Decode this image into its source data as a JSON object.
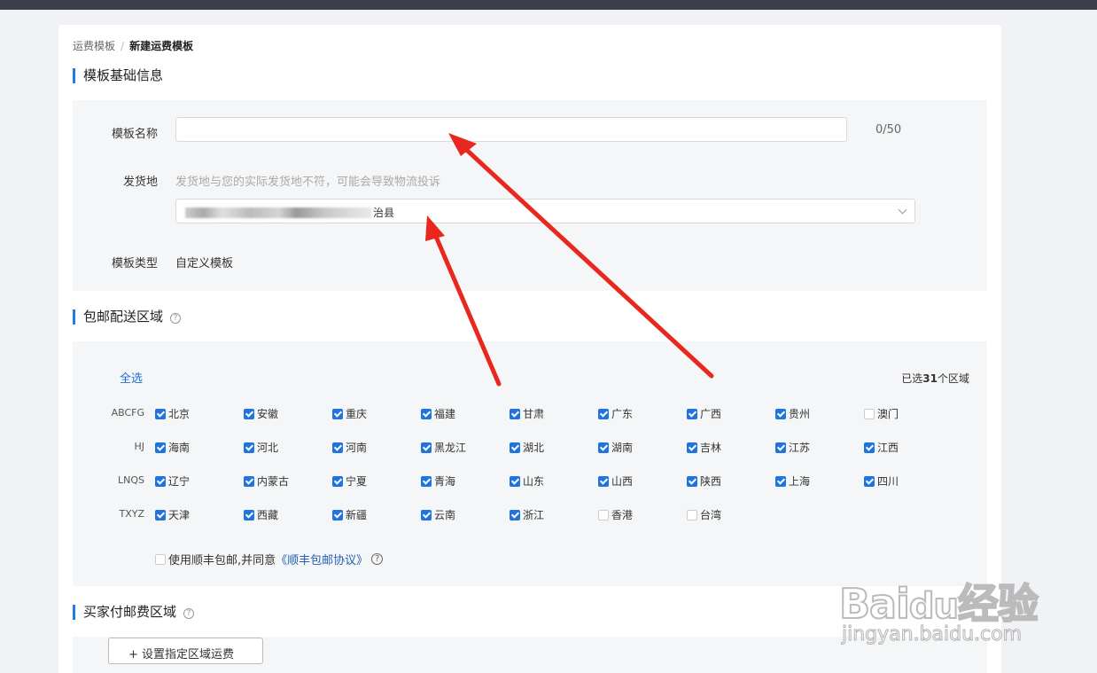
{
  "breadcrumb": {
    "parent": "运费模板",
    "separator": "/",
    "current": "新建运费模板"
  },
  "basic_section": {
    "title": "模板基础信息",
    "name_label": "模板名称",
    "name_value": "",
    "name_counter": "0/50",
    "origin_label": "发货地",
    "origin_hint": "发货地与您的实际发货地不符，可能会导致物流投诉",
    "origin_value_suffix": "治县",
    "type_label": "模板类型",
    "type_value": "自定义模板"
  },
  "free_section": {
    "title": "包邮配送区域",
    "help": "?",
    "select_all": "全选",
    "selected_prefix": "已选",
    "selected_count": "31",
    "selected_suffix": "个区域",
    "groups": [
      {
        "label": "ABCFG",
        "items": [
          {
            "name": "北京",
            "checked": true
          },
          {
            "name": "安徽",
            "checked": true
          },
          {
            "name": "重庆",
            "checked": true
          },
          {
            "name": "福建",
            "checked": true
          },
          {
            "name": "甘肃",
            "checked": true
          },
          {
            "name": "广东",
            "checked": true
          },
          {
            "name": "广西",
            "checked": true
          },
          {
            "name": "贵州",
            "checked": true
          },
          {
            "name": "澳门",
            "checked": false
          }
        ]
      },
      {
        "label": "HJ",
        "items": [
          {
            "name": "海南",
            "checked": true
          },
          {
            "name": "河北",
            "checked": true
          },
          {
            "name": "河南",
            "checked": true
          },
          {
            "name": "黑龙江",
            "checked": true
          },
          {
            "name": "湖北",
            "checked": true
          },
          {
            "name": "湖南",
            "checked": true
          },
          {
            "name": "吉林",
            "checked": true
          },
          {
            "name": "江苏",
            "checked": true
          },
          {
            "name": "江西",
            "checked": true
          }
        ]
      },
      {
        "label": "LNQS",
        "items": [
          {
            "name": "辽宁",
            "checked": true
          },
          {
            "name": "内蒙古",
            "checked": true
          },
          {
            "name": "宁夏",
            "checked": true
          },
          {
            "name": "青海",
            "checked": true
          },
          {
            "name": "山东",
            "checked": true
          },
          {
            "name": "山西",
            "checked": true
          },
          {
            "name": "陕西",
            "checked": true
          },
          {
            "name": "上海",
            "checked": true
          },
          {
            "name": "四川",
            "checked": true
          }
        ]
      },
      {
        "label": "TXYZ",
        "items": [
          {
            "name": "天津",
            "checked": true
          },
          {
            "name": "西藏",
            "checked": true
          },
          {
            "name": "新疆",
            "checked": true
          },
          {
            "name": "云南",
            "checked": true
          },
          {
            "name": "浙江",
            "checked": true
          },
          {
            "name": "香港",
            "checked": false
          },
          {
            "name": "台湾",
            "checked": false
          }
        ]
      }
    ],
    "sf_text": "使用顺丰包邮,并同意",
    "sf_link": "《顺丰包邮协议》",
    "sf_checked": false
  },
  "paid_section": {
    "title": "买家付邮费区域",
    "help": "?",
    "set_button": "+ 设置指定区域运费"
  },
  "colors": {
    "accent": "#1f74e0",
    "arrow": "#e8281e",
    "topbar": "#3b3f4a"
  },
  "watermark": {
    "brand": "Baidu经验",
    "url": "jingyan.baidu.com"
  }
}
